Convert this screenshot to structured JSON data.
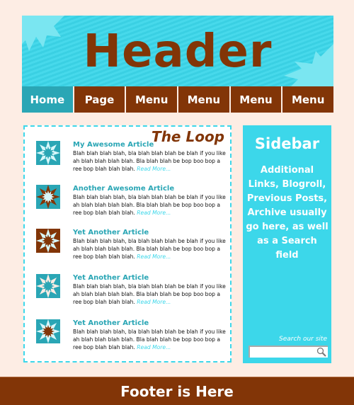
{
  "header": {
    "title": "Header"
  },
  "nav": {
    "items": [
      {
        "label": "Home",
        "active": true
      },
      {
        "label": "Page"
      },
      {
        "label": "Menu"
      },
      {
        "label": "Menu"
      },
      {
        "label": "Menu"
      },
      {
        "label": "Menu"
      }
    ]
  },
  "loop": {
    "title": "The Loop",
    "articles": [
      {
        "title": "My Awesome Article",
        "text": "Blah blah blah blah, bla blah blah blah be blah if you like ah blah blah blah blah. Bla blah blah be bop boo bop a ree bop blah blah blah.",
        "read_more": "Read More...",
        "icon": "starburst-teal-icon"
      },
      {
        "title": "Another Awesome Article",
        "text": "Blah blah blah blah, bla blah blah blah be blah if you like ah blah blah blah blah. Bla blah blah be bop boo bop a ree bop blah blah blah.",
        "read_more": "Read More...",
        "icon": "starburst-brown-icon"
      },
      {
        "title": "Yet Another Article",
        "text": "Blah blah blah blah, bla blah blah blah be blah if you like ah blah blah blah blah. Bla blah blah be bop boo bop a ree bop blah blah blah.",
        "read_more": "Read More...",
        "icon": "starburst-brown-bg-icon"
      },
      {
        "title": "Yet Another Article",
        "text": "Blah blah blah blah, bla blah blah blah be blah if you like ah blah blah blah blah. Bla blah blah be bop boo bop a ree bop blah blah blah.",
        "read_more": "Read More...",
        "icon": "starburst-peach-icon"
      },
      {
        "title": "Yet Another Article",
        "text": "Blah blah blah blah, bla blah blah blah be blah if you like ah blah blah blah blah. Bla blah blah be bop boo bop a ree bop blah blah blah.",
        "read_more": "Read More...",
        "icon": "starburst-light-icon"
      }
    ]
  },
  "sidebar": {
    "title": "Sidebar",
    "text": "Additional Links, Blogroll, Previous Posts, Archive usually go here, as well as a Search field",
    "search_label": "Search our site",
    "search_value": ""
  },
  "footer": {
    "text": "Footer is Here"
  },
  "colors": {
    "brown": "#823507",
    "cyan": "#3cd7ea",
    "teal": "#2aa6b5",
    "background": "#fdede4",
    "pale": "#d9f8fb"
  }
}
